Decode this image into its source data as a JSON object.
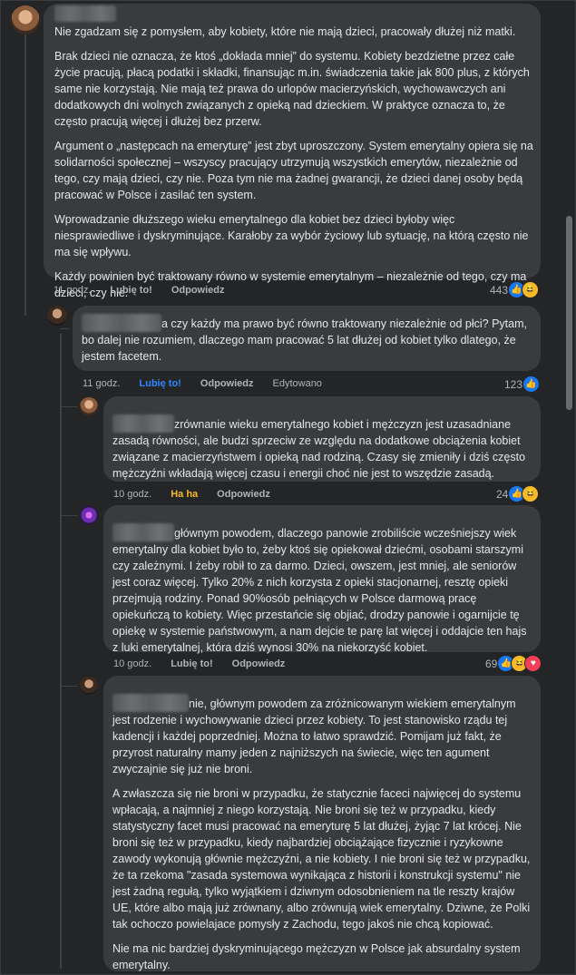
{
  "comments": [
    {
      "paragraphs": [
        "Nie zgadzam się z pomysłem, aby kobiety, które nie mają dzieci, pracowały dłużej niż matki.",
        "Brak dzieci nie oznacza, że ktoś „dokłada mniej” do systemu. Kobiety bezdzietne przez całe życie pracują, płacą podatki i składki, finansując m.in. świadczenia takie jak 800 plus, z których same nie korzystają. Nie mają też prawa do urlopów macierzyńskich, wychowawczych ani dodatkowych dni wolnych związanych z opieką nad dzieckiem. W praktyce oznacza to, że często pracują więcej i dłużej bez przerw.",
        "Argument o „następcach na emeryturę” jest zbyt uproszczony. System emerytalny opiera się na solidarności społecznej – wszyscy pracujący utrzymują wszystkich emerytów, niezależnie od tego, czy mają dzieci, czy nie. Poza tym nie ma żadnej gwarancji, że dzieci danej osoby będą pracować w Polsce i zasilać ten system.",
        "Wprowadzanie dłuższego wieku emerytalnego dla kobiet bez dzieci byłoby więc niesprawiedliwe i dyskryminujące. Karałoby za wybór życiowy lub sytuację, na którą często nie ma się wpływu.",
        "Każdy powinien być traktowany równo w systemie emerytalnym – niezależnie od tego, czy ma dzieci, czy nie."
      ],
      "time": "11 godz.",
      "like_label": "Lubię to!",
      "reply_label": "Odpowiedz",
      "reaction_count": "443"
    },
    {
      "text": "a czy każdy ma prawo być równo traktowany niezależnie od płci? Pytam, bo dalej nie rozumiem, dlaczego mam pracować 5 lat dłużej od kobiet tylko dlatego, że jestem facetem.",
      "time": "11 godz.",
      "like_label": "Lubię to!",
      "reply_label": "Odpowiedz",
      "edited_label": "Edytowano",
      "reaction_count": "123"
    },
    {
      "text": "zrównanie wieku emerytalnego kobiet i mężczyzn jest uzasadniane zasadą równości, ale budzi sprzeciw ze względu na dodatkowe obciążenia kobiet związane z macierzyństwem i opieką nad rodziną. Czasy się zmieniły i dziś często mężczyźni wkładają więcej czasu i energii choć nie jest to wszędzie zasadą.",
      "time": "10 godz.",
      "like_label": "Ha ha",
      "reply_label": "Odpowiedz",
      "reaction_count": "24"
    },
    {
      "text": "głównym powodem, dlaczego panowie zrobiliście wcześniejszy wiek emerytalny dla kobiet było to, żeby ktoś się opiekował dziećmi, osobami starszymi czy zależnymi. I żeby robił to za darmo. Dzieci, owszem, jest mniej, ale seniorów jest coraz więcej. Tylko 20% z nich korzysta z opieki stacjonarnej, resztę opieki przejmują rodziny. Ponad 90%osób pełniących w Polsce darmową pracę opiekuńczą to kobiety. Więc przestańcie się objiać, drodzy panowie i ogarnijcie tę opiekę w systemie państwowym, a nam dejcie te parę lat więcej i oddajcie ten hajs z luki emerytalnej, która dziś wynosi 30% na niekorzyść kobiet.",
      "time": "10 godz.",
      "like_label": "Lubię to!",
      "reply_label": "Odpowiedz",
      "reaction_count": "69"
    },
    {
      "first_text": "nie, głównym powodem za zróżnicowanym wiekiem emerytalnym jest rodzenie i wychowywanie dzieci przez kobiety. To jest stanowisko rządu tej kadencji i każdej poprzedniej. Można to łatwo sprawdzić. Pomijam już fakt, że przyrost naturalny mamy jeden z najniższych na świecie, więc ten agument zwyczajnie się już nie broni.",
      "paragraphs": [
        "A zwłaszcza się nie broni w przypadku, że statycznie faceci najwięcej do systemu wpłacają, a najmniej z niego korzystają. Nie broni się też w przypadku, kiedy statystyczny facet musi pracować na emeryturę 5 lat dłużej, żyjąc 7 lat krócej. Nie broni się też w przypadku, kiedy najbardziej obciążające fizycznie i ryzykowne zawody wykonują głównie mężczyźni, a nie kobiety. I nie broni się też w przypadku, że ta rzekoma \"zasada systemowa wynikająca z historii i konstrukcji systemu\" nie jest żadną regułą, tylko wyjątkiem i dziwnym odosobnieniem na tle reszty krajów UE, które albo mają już zrównany, albo zrównują wiek emerytalny. Dziwne, że Polki tak ochoczo powielajace pomysły z Zachodu, tego jakoś nie chcą kopiować.",
        "Nie ma nic bardziej dyskryminującego mężczyzn w Polsce jak absurdalny system emerytalny."
      ]
    }
  ],
  "icons": {
    "like": "thumbs-up-icon",
    "haha": "laughing-face-icon",
    "love": "heart-icon"
  },
  "colors": {
    "background": "#242526",
    "bubble": "#3a3b3c",
    "text": "#e4e6eb",
    "meta": "#b0b3b8",
    "liked": "#2d88ff",
    "haha": "#f7b928"
  }
}
